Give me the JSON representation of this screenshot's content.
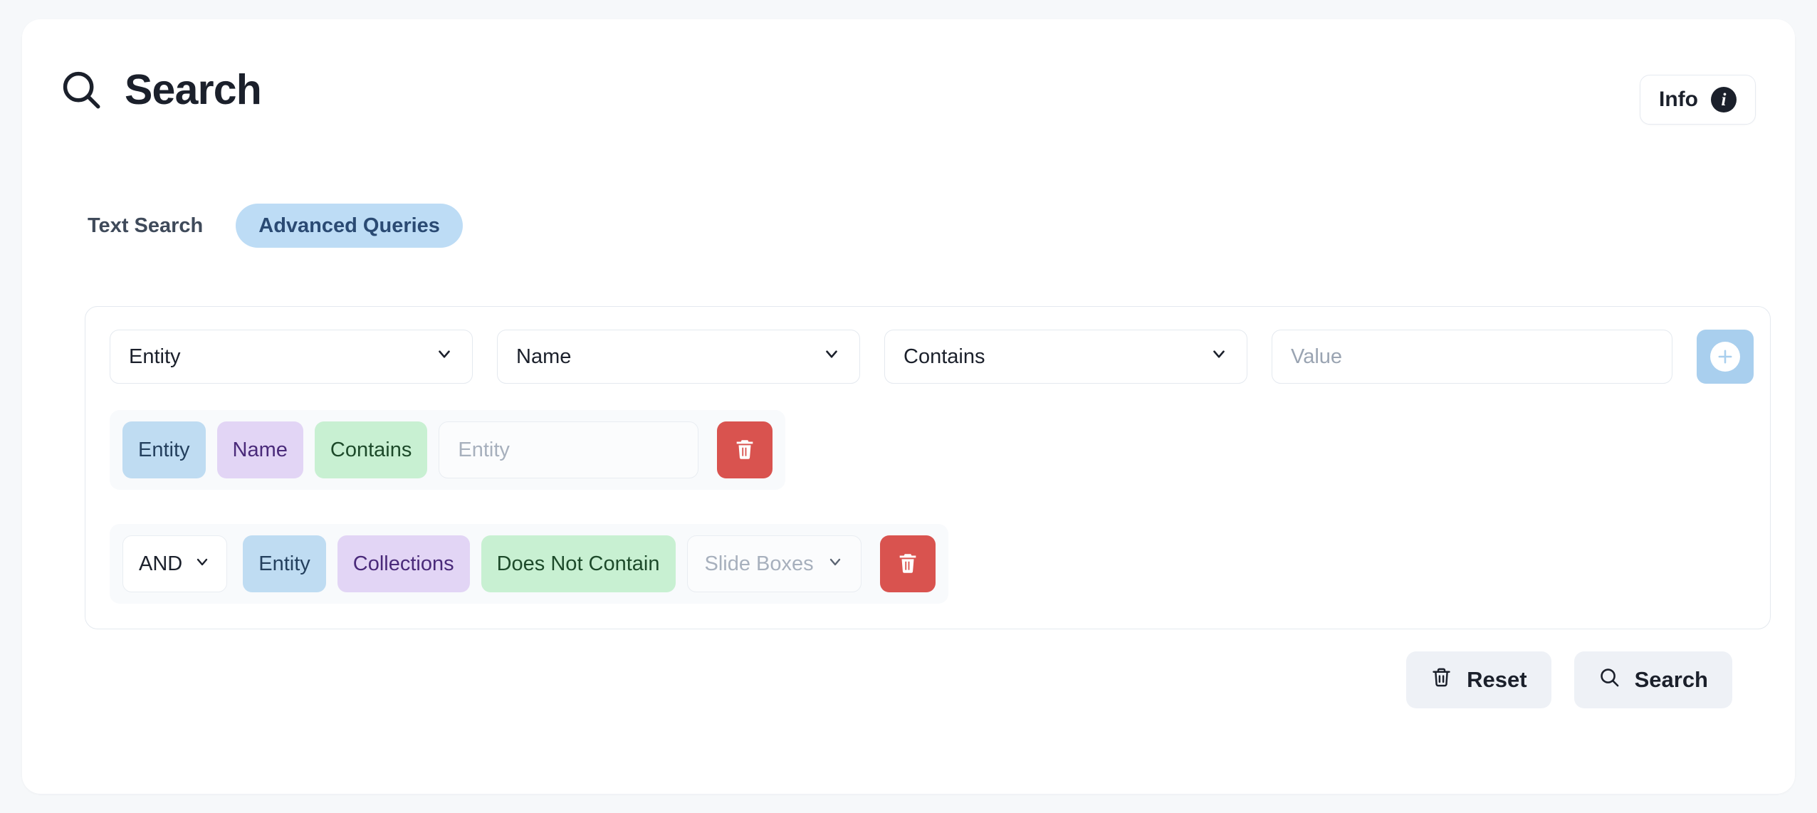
{
  "header": {
    "title": "Search",
    "search_icon": "search-icon",
    "info": {
      "label": "Info",
      "badge": "i",
      "badge_icon": "info-circle-icon"
    }
  },
  "tabs": [
    {
      "label": "Text Search",
      "active": false
    },
    {
      "label": "Advanced Queries",
      "active": true
    }
  ],
  "query_builder": {
    "input_row": {
      "entity_select": {
        "value": "Entity",
        "chevron": "chevron-down-icon"
      },
      "field_select": {
        "value": "Name",
        "chevron": "chevron-down-icon"
      },
      "operator_select": {
        "value": "Contains",
        "chevron": "chevron-down-icon"
      },
      "value_input": {
        "value": "",
        "placeholder": "Value"
      },
      "add_button": {
        "icon": "plus-icon",
        "label": ""
      }
    },
    "conditions": [
      {
        "logic": null,
        "entity": "Entity",
        "field": "Name",
        "operator": "Contains",
        "value_input": {
          "type": "text",
          "value": "",
          "placeholder": "Entity"
        },
        "delete_icon": "trash-icon"
      },
      {
        "logic": "AND",
        "entity": "Entity",
        "field": "Collections",
        "operator": "Does Not Contain",
        "value_input": {
          "type": "select",
          "value": "",
          "placeholder": "Slide Boxes",
          "chevron": "chevron-down-icon"
        },
        "delete_icon": "trash-icon"
      }
    ]
  },
  "actions": {
    "reset": {
      "label": "Reset",
      "icon": "trash-icon"
    },
    "search": {
      "label": "Search",
      "icon": "search-icon"
    }
  },
  "colors": {
    "page_background": "#f6f8fa",
    "card_background": "#ffffff",
    "tab_active_bg": "#bddcf5",
    "tab_active_text": "#2a4a73",
    "chip_entity_bg": "#bfdcf2",
    "chip_field_bg": "#e2d5f5",
    "chip_operator_bg": "#c8f0d2",
    "add_button_bg": "#a9cfee",
    "delete_button_bg": "#d9534f",
    "action_button_bg": "#eef1f6",
    "border": "#e4e9ef"
  }
}
